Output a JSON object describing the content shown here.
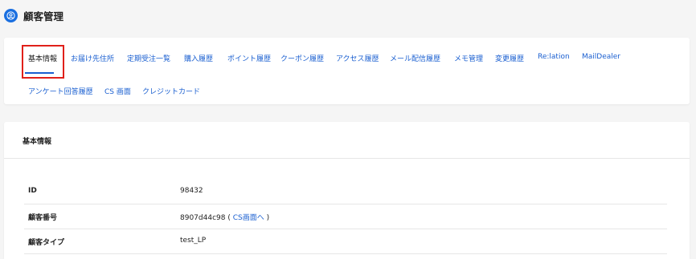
{
  "header": {
    "title": "顧客管理",
    "icon": "user-circle-icon",
    "accent": "#1a6fe0"
  },
  "tabs": [
    {
      "label": "基本情報",
      "active": true
    },
    {
      "label": "お届け先住所"
    },
    {
      "label": "定期受注一覧"
    },
    {
      "label": "購入履歴"
    },
    {
      "label": "ポイント履歴"
    },
    {
      "label": "クーポン履歴"
    },
    {
      "label": "アクセス履歴"
    },
    {
      "label": "メール配信履歴"
    },
    {
      "label": "メモ管理"
    },
    {
      "label": "変更履歴"
    },
    {
      "label": "Re:lation"
    },
    {
      "label": "MailDealer"
    },
    {
      "label": "アンケート回答履歴"
    },
    {
      "label": "CS 画面"
    },
    {
      "label": "クレジットカード"
    }
  ],
  "basic_info": {
    "title": "基本情報",
    "rows": [
      {
        "label": "ID",
        "value": "98432"
      },
      {
        "label": "顧客番号",
        "value": "8907d44c98",
        "link_prefix": "( ",
        "link": "CS画面へ",
        "link_suffix": " )"
      },
      {
        "label": "顧客タイプ",
        "value": "test_LP"
      }
    ]
  },
  "colors": {
    "link": "#1a5fd0",
    "highlight": "#e0201a"
  }
}
